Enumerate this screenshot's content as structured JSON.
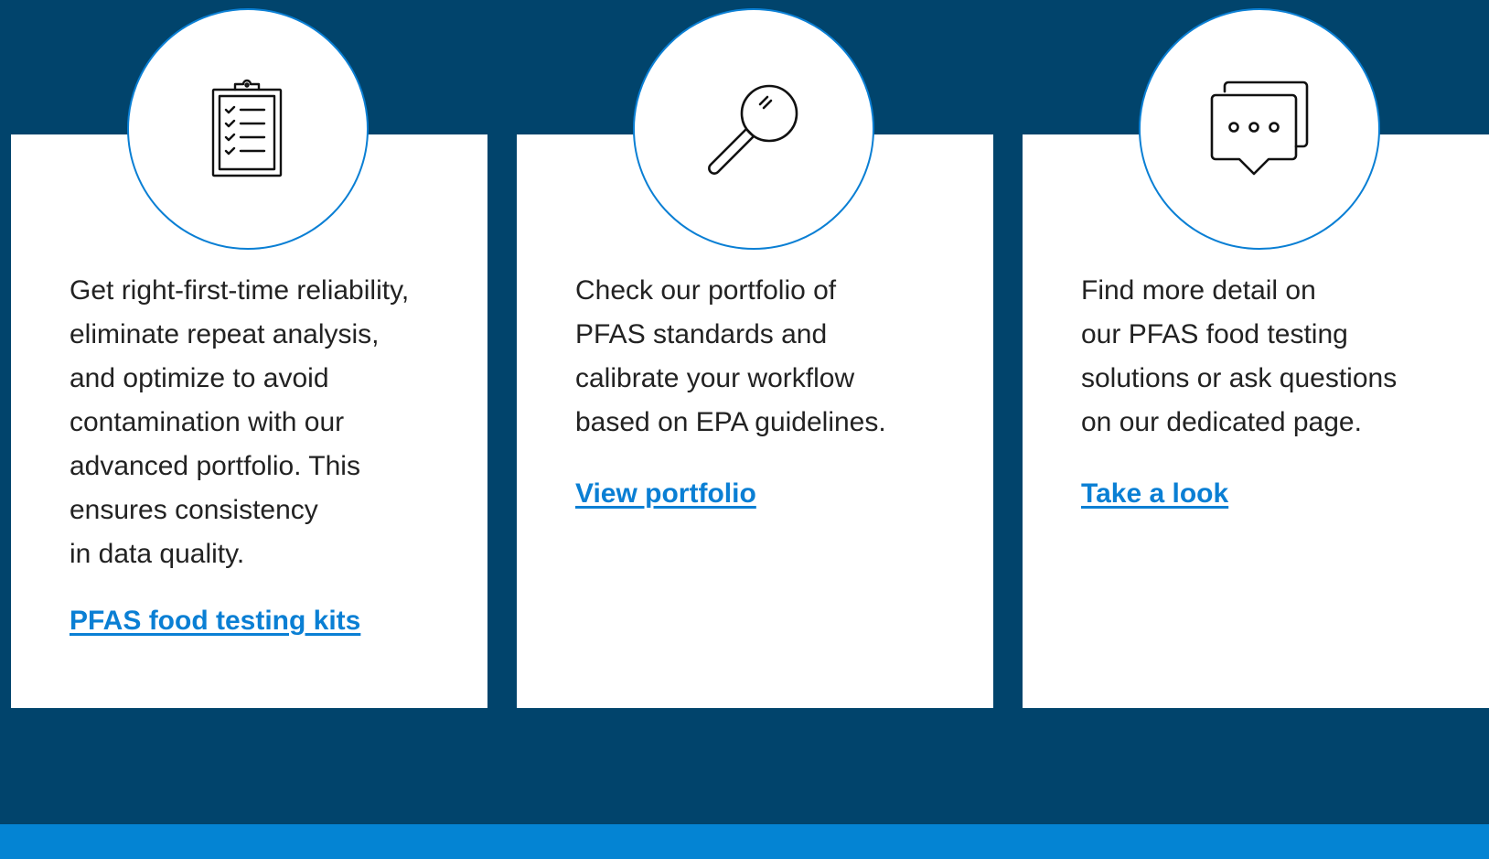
{
  "cards": [
    {
      "icon": "clipboard-checklist-icon",
      "text": "Get right-first-time reliability,\neliminate repeat analysis,\nand optimize to avoid\ncontamination with our\nadvanced portfolio. This\nensures consistency\nin data quality.",
      "link": "PFAS food testing kits"
    },
    {
      "icon": "magnifying-glass-icon",
      "text": "Check our portfolio of\nPFAS standards and\ncalibrate your workflow\nbased on EPA guidelines.",
      "link": "View portfolio"
    },
    {
      "icon": "chat-bubbles-icon",
      "text": "Find more detail on\nour PFAS food testing\nsolutions or ask questions\non our dedicated page.",
      "link": "Take a look"
    }
  ],
  "colors": {
    "background": "#01446c",
    "card": "#ffffff",
    "accent": "#0a7fd4",
    "bottom_band": "#0484d3",
    "text": "#222222"
  }
}
